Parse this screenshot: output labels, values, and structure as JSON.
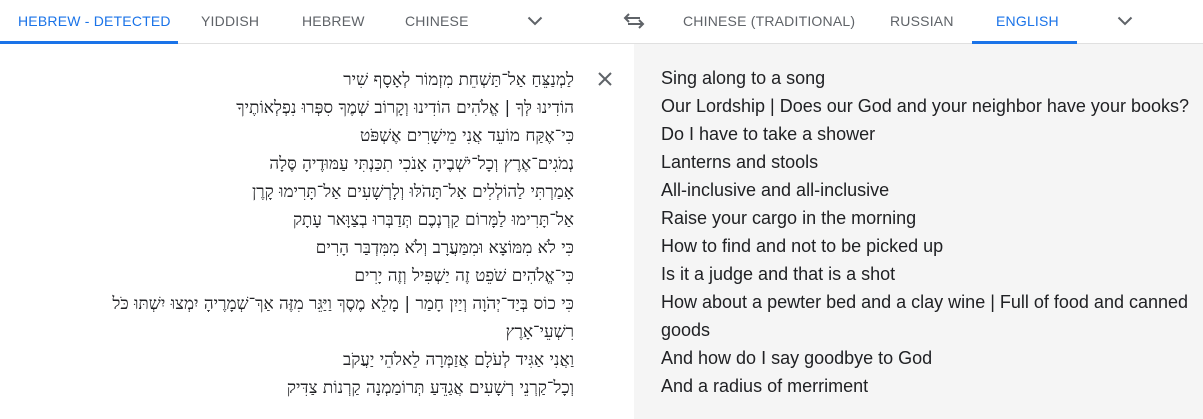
{
  "source_tabs": [
    {
      "label": "HEBREW - DETECTED",
      "active": true
    },
    {
      "label": "YIDDISH",
      "active": false
    },
    {
      "label": "HEBREW",
      "active": false
    },
    {
      "label": "CHINESE",
      "active": false
    }
  ],
  "target_tabs": [
    {
      "label": "CHINESE (TRADITIONAL)",
      "active": false
    },
    {
      "label": "RUSSIAN",
      "active": false
    },
    {
      "label": "ENGLISH",
      "active": true
    }
  ],
  "icons": {
    "more_source": "chevron-down-icon",
    "swap": "swap-arrows-icon",
    "more_target": "chevron-down-icon",
    "clear": "close-icon"
  },
  "colors": {
    "accent": "#1a73e8",
    "tab_text": "#5f6368",
    "target_bg": "#f5f5f5"
  },
  "source": {
    "lines": [
      "לַמְנַצֵּחַ אַל־תַּשְׁחֵת מִזְמוֹר לְאָסָף שִׁיר",
      "הוֹדִינוּ לְּךָ | אֱלֹהִים הוֹדִינוּ וְקָרוֹב שְׁמֶךָ סִפְּרוּ נִפְלְאוֹתֶיךָ",
      "כִּי־אֶקַּח מוֹעֵד אֲנִי מֵישָׁרִים אֶשְׁפֹּט",
      "נְמֹגִים־אֶרֶץ וְכָל־יֹשְׁבֶיהָ אָנֹכִי תִכַּנְתִּי עַמּוּדֶיהָ סֶּלָה",
      "אָמַרְתִּי לַהוֹלְלִים אַל־תָּהֹלּוּ וְלָרְשָׁעִים אַל־תָּרִימוּ קָרֶן",
      "אַל־תָּרִימוּ לַמָּרוֹם קַרְנְכֶם תְּדַבְּרוּ בְצַוָּאר עָתָק",
      "כִּי לֹא מִמּוֹצָא וּמִמַּעֲרָב וְלֹא מִמִּדְבַּר הָרִים",
      "כִּי־אֱלֹהִים שֹׁפֵט זֶה יַשְׁפִּיל וְזֶה יָרִים",
      "כִּי כוֹס בְּיַד־יְהֹוָה וְיַיִן חָמַר | מָלֵא מֶסֶךְ וַיַּגֵּר מִזֶּה אַךְ־שְׁמָרֶיהָ יִמְצוּ יִשְׁתּוּ כֹּל",
      "רִשְׁעֵי־אָרֶץ",
      "וַאֲנִי אַגִּיד לְעֹלָם אֲזַמְּרָה לֵאלֹהֵי יַעֲקֹב",
      "וְכָל־קַרְנֵי רְשָׁעִים אֲגַדֵּעַ תְּרוֹמַמְנָה קַרְנוֹת צַדִּיק"
    ]
  },
  "target": {
    "lines": [
      "Sing along to a song",
      "Our Lordship | Does our God and your neighbor have your books?",
      "Do I have to take a shower",
      "Lanterns and stools",
      "All-inclusive and all-inclusive",
      "Raise your cargo in the morning",
      "How to find and not to be picked up",
      "Is it a judge and that is a shot",
      "How about a pewter bed and a clay wine | Full of food and canned",
      "goods",
      "And how do I say goodbye to God",
      "And a radius of merriment"
    ]
  }
}
